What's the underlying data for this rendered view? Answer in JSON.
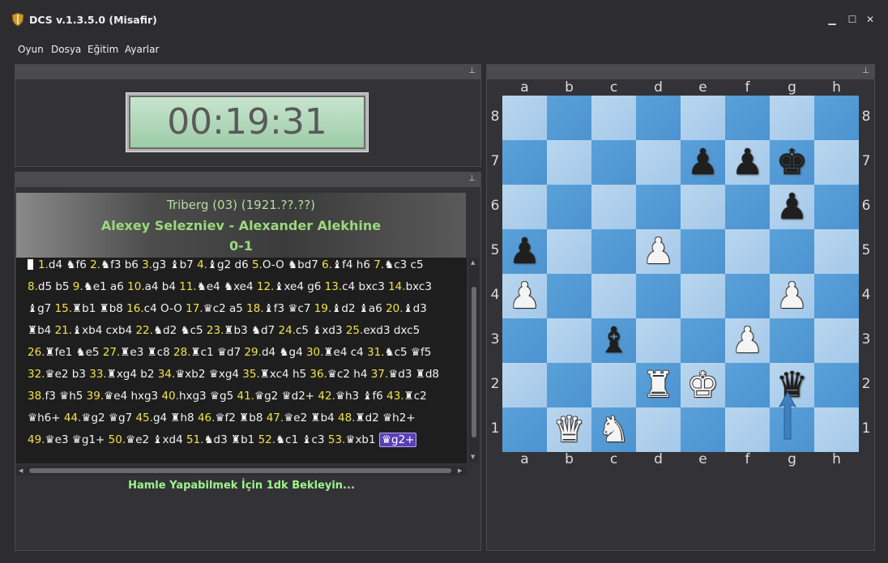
{
  "window": {
    "title": "DCS v.1.3.5.0 (Misafir)",
    "min": "▁",
    "max": "☐",
    "close": "✕"
  },
  "menu": [
    "Oyun",
    "Dosya",
    "Eğitim",
    "Ayarlar"
  ],
  "clock": {
    "time": "00:19:31"
  },
  "pin_glyph": "⊥",
  "game": {
    "event": "Triberg (03) (1921.??.??)",
    "players": "Alexey Selezniev - Alexander Alekhine",
    "result": "0-1"
  },
  "status": "Hamle Yapabilmek İçin 1dk Bekleyin...",
  "moves": [
    {
      "n": "1.",
      "t": "d4 ♞f6 "
    },
    {
      "n": "2.",
      "t": "♞f3 b6 "
    },
    {
      "n": "3.",
      "t": "g3 ♝b7 "
    },
    {
      "n": "4.",
      "t": "♝g2 d6 "
    },
    {
      "n": "5.",
      "t": "O-O ♞bd7 "
    },
    {
      "n": "6.",
      "t": "♝f4 h6 "
    },
    {
      "n": "7.",
      "t": "♞c3 c5 "
    },
    {
      "n": "8.",
      "t": "d5 b5 "
    },
    {
      "n": "9.",
      "t": "♞e1 a6 "
    },
    {
      "n": "10.",
      "t": "a4 b4 "
    },
    {
      "n": "11.",
      "t": "♞e4 ♞xe4 "
    },
    {
      "n": "12.",
      "t": "♝xe4 g6 "
    },
    {
      "n": "13.",
      "t": "c4 bxc3 "
    },
    {
      "n": "14.",
      "t": "bxc3 ♝g7 "
    },
    {
      "n": "15.",
      "t": "♜b1 ♜b8 "
    },
    {
      "n": "16.",
      "t": "c4 O-O "
    },
    {
      "n": "17.",
      "t": "♛c2 a5 "
    },
    {
      "n": "18.",
      "t": "♝f3 ♛c7 "
    },
    {
      "n": "19.",
      "t": "♝d2 ♝a6 "
    },
    {
      "n": "20.",
      "t": "♝d3 ♜b4 "
    },
    {
      "n": "21.",
      "t": "♝xb4 cxb4 "
    },
    {
      "n": "22.",
      "t": "♞d2 ♞c5 "
    },
    {
      "n": "23.",
      "t": "♜b3 ♞d7 "
    },
    {
      "n": "24.",
      "t": "c5 ♝xd3 "
    },
    {
      "n": "25.",
      "t": "exd3 dxc5 "
    },
    {
      "n": "26.",
      "t": "♜fe1 ♞e5 "
    },
    {
      "n": "27.",
      "t": "♜e3 ♜c8 "
    },
    {
      "n": "28.",
      "t": "♜c1 ♛d7 "
    },
    {
      "n": "29.",
      "t": "d4 ♞g4 "
    },
    {
      "n": "30.",
      "t": "♜e4 c4 "
    },
    {
      "n": "31.",
      "t": "♞c5 ♛f5 "
    },
    {
      "n": "32.",
      "t": "♛e2 b3 "
    },
    {
      "n": "33.",
      "t": "♜xg4 b2 "
    },
    {
      "n": "34.",
      "t": "♛xb2 ♛xg4 "
    },
    {
      "n": "35.",
      "t": "♜xc4 h5 "
    },
    {
      "n": "36.",
      "t": "♛c2 h4 "
    },
    {
      "n": "37.",
      "t": "♛d3 ♜d8 "
    },
    {
      "n": "38.",
      "t": "f3 ♛h5 "
    },
    {
      "n": "39.",
      "t": "♛e4 hxg3 "
    },
    {
      "n": "40.",
      "t": "hxg3 ♛g5 "
    },
    {
      "n": "41.",
      "t": "♛g2 ♛d2+ "
    },
    {
      "n": "42.",
      "t": "♛h3 ♝f6 "
    },
    {
      "n": "43.",
      "t": "♜c2 ♛h6+ "
    },
    {
      "n": "44.",
      "t": "♛g2 ♛g7 "
    },
    {
      "n": "45.",
      "t": "g4 ♜h8 "
    },
    {
      "n": "46.",
      "t": "♛f2 ♜b8 "
    },
    {
      "n": "47.",
      "t": "♛e2 ♜b4 "
    },
    {
      "n": "48.",
      "t": "♜d2 ♛h2+ "
    },
    {
      "n": "49.",
      "t": "♛e3 ♛g1+ "
    },
    {
      "n": "50.",
      "t": "♛e2 ♝xd4 "
    },
    {
      "n": "51.",
      "t": "♞d3 ♜b1 "
    },
    {
      "n": "52.",
      "t": "♞c1 ♝c3 "
    },
    {
      "n": "53.",
      "t": "♛xb1 "
    }
  ],
  "current_move": "♛g2+",
  "board": {
    "files": [
      "a",
      "b",
      "c",
      "d",
      "e",
      "f",
      "g",
      "h"
    ],
    "ranks": [
      "8",
      "7",
      "6",
      "5",
      "4",
      "3",
      "2",
      "1"
    ],
    "pieces": [
      {
        "sq": "e7",
        "glyph": "♟",
        "color": "black",
        "name": "black-pawn-e7"
      },
      {
        "sq": "f7",
        "glyph": "♟",
        "color": "black",
        "name": "black-pawn-f7"
      },
      {
        "sq": "g7",
        "glyph": "♚",
        "color": "black",
        "name": "black-king-g7"
      },
      {
        "sq": "g6",
        "glyph": "♟",
        "color": "black",
        "name": "black-pawn-g6"
      },
      {
        "sq": "a5",
        "glyph": "♟",
        "color": "black",
        "name": "black-pawn-a5"
      },
      {
        "sq": "d5",
        "glyph": "♟",
        "color": "white",
        "name": "white-pawn-d5"
      },
      {
        "sq": "a4",
        "glyph": "♟",
        "color": "white",
        "name": "white-pawn-a4"
      },
      {
        "sq": "g4",
        "glyph": "♟",
        "color": "white",
        "name": "white-pawn-g4"
      },
      {
        "sq": "c3",
        "glyph": "♝",
        "color": "black",
        "name": "black-bishop-c3"
      },
      {
        "sq": "f3",
        "glyph": "♟",
        "color": "white",
        "name": "white-pawn-f3"
      },
      {
        "sq": "d2",
        "glyph": "♜",
        "color": "white",
        "name": "white-rook-d2"
      },
      {
        "sq": "e2",
        "glyph": "♚",
        "color": "white",
        "name": "white-king-e2"
      },
      {
        "sq": "g2",
        "glyph": "♛",
        "color": "black",
        "name": "black-queen-g2"
      },
      {
        "sq": "b1",
        "glyph": "♛",
        "color": "white",
        "name": "white-queen-b1"
      },
      {
        "sq": "c1",
        "glyph": "♞",
        "color": "white",
        "name": "white-knight-c1"
      }
    ]
  }
}
